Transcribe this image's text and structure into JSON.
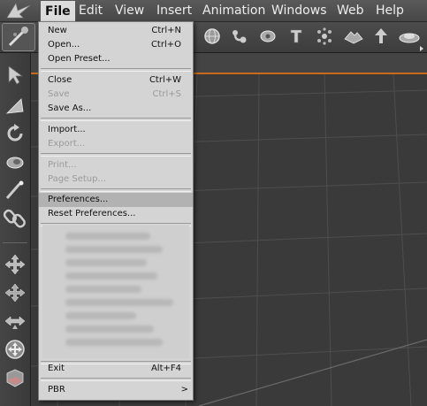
{
  "menubar": {
    "items": [
      {
        "label": "File"
      },
      {
        "label": "Edit"
      },
      {
        "label": "View"
      },
      {
        "label": "Insert"
      },
      {
        "label": "Animation"
      },
      {
        "label": "Windows"
      },
      {
        "label": "Web"
      },
      {
        "label": "Help"
      }
    ]
  },
  "toolbar": {
    "icons": [
      "globe-icon",
      "bones-icon",
      "morph-icon",
      "text-icon",
      "particles-icon",
      "terrain-icon",
      "tree-icon",
      "pool-icon"
    ]
  },
  "file_menu": {
    "new": {
      "label": "New",
      "shortcut": "Ctrl+N"
    },
    "open": {
      "label": "Open...",
      "shortcut": "Ctrl+O"
    },
    "open_preset": {
      "label": "Open Preset..."
    },
    "close": {
      "label": "Close",
      "shortcut": "Ctrl+W"
    },
    "save": {
      "label": "Save",
      "shortcut": "Ctrl+S"
    },
    "save_as": {
      "label": "Save As..."
    },
    "import": {
      "label": "Import..."
    },
    "export": {
      "label": "Export..."
    },
    "print": {
      "label": "Print..."
    },
    "page_setup": {
      "label": "Page Setup..."
    },
    "preferences": {
      "label": "Preferences..."
    },
    "reset_preferences": {
      "label": "Reset Preferences..."
    },
    "exit": {
      "label": "Exit",
      "shortcut": "Alt+F4"
    },
    "pbr": {
      "label": "PBR",
      "arrow": ">"
    }
  },
  "colors": {
    "menubar": "#4f4f4f",
    "menu_background": "#d4d4d4",
    "highlight": "#b2b2b2",
    "viewport_accent": "#c86a1a"
  }
}
